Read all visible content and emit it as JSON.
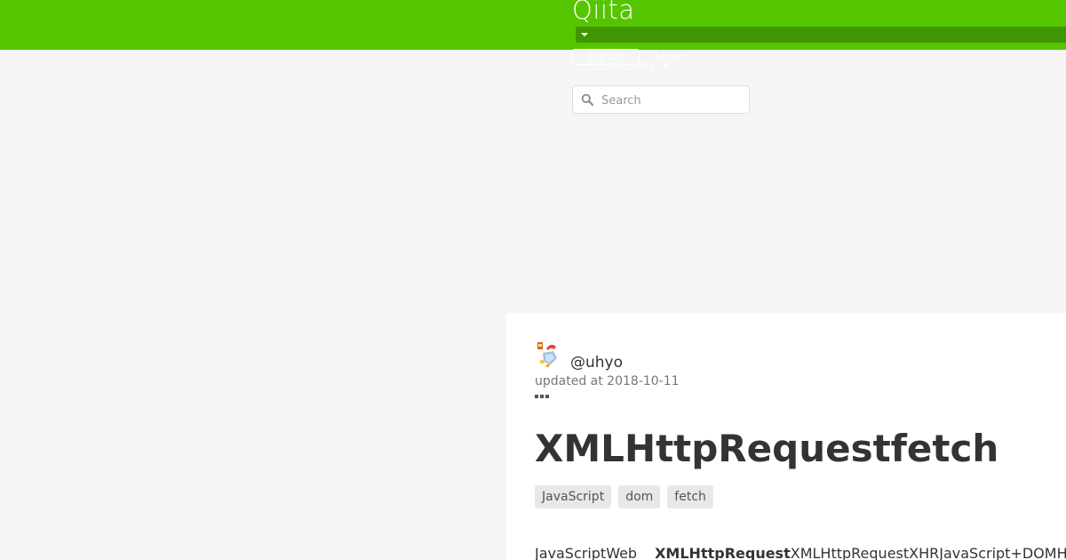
{
  "header": {
    "logo": "Qiita",
    "signup_label": "Signup",
    "login_label": "Login",
    "community_label": "Community",
    "brand_color": "#55c500"
  },
  "search": {
    "placeholder": "Search",
    "value": ""
  },
  "article": {
    "author": "@uhyo",
    "updated": "updated at 2018-10-11",
    "title": "XMLHttpRequestfetch",
    "tags": [
      "JavaScript",
      "dom",
      "fetch"
    ],
    "body_lead": "JavaScriptWeb",
    "body_bold": "XMLHttpRequest",
    "body_rest": "XMLHttpRequestXHRJavaScript+DOMH"
  }
}
